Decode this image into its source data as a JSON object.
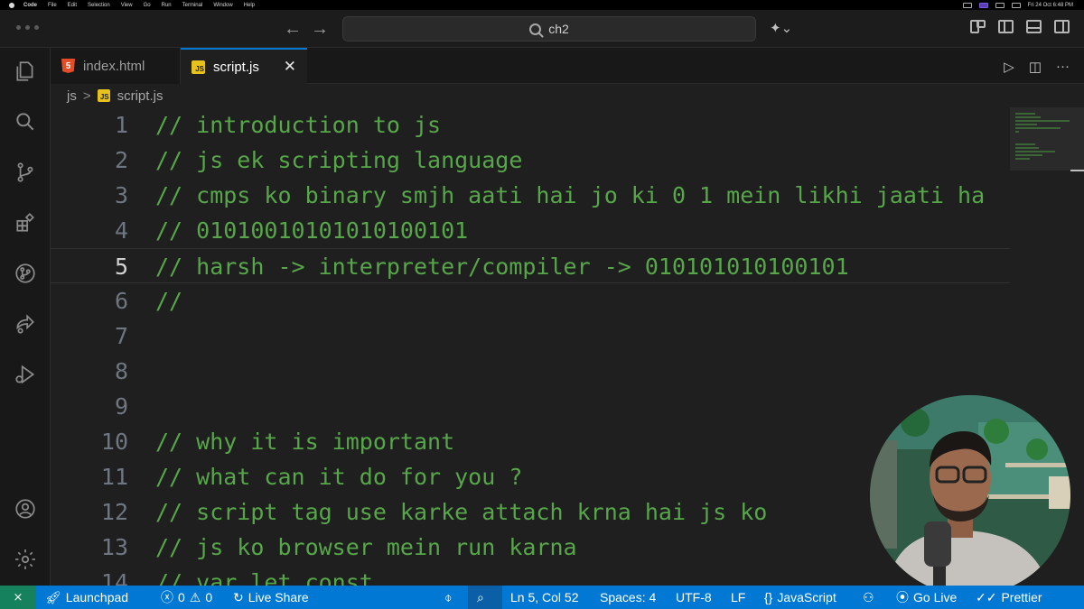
{
  "menubar": {
    "app": "Code",
    "items": [
      "File",
      "Edit",
      "Selection",
      "View",
      "Go",
      "Run",
      "Terminal",
      "Window",
      "Help"
    ],
    "clock": "Fri 24 Oct  6:48 PM"
  },
  "titlebar": {
    "search_text": "ch2",
    "back_arrow": "←",
    "forward_arrow": "→"
  },
  "tabs": [
    {
      "label": "index.html",
      "icon": "html5-icon",
      "active": false
    },
    {
      "label": "script.js",
      "icon": "js-icon",
      "active": true,
      "close": "✕"
    }
  ],
  "editor_actions": {
    "run": "▷",
    "more": "···"
  },
  "breadcrumb": {
    "folder": "js",
    "separator": ">",
    "file": "script.js"
  },
  "code_lines": [
    {
      "n": "1",
      "text": "// introduction to js"
    },
    {
      "n": "2",
      "text": "// js ek scripting language"
    },
    {
      "n": "3",
      "text": "// cmps ko binary smjh aati hai jo ki 0 1 mein likhi jaati ha"
    },
    {
      "n": "4",
      "text": "// 01010010101010100101"
    },
    {
      "n": "5",
      "text": "// harsh -> interpreter/compiler -> 010101010100101"
    },
    {
      "n": "6",
      "text": "//"
    },
    {
      "n": "7",
      "text": ""
    },
    {
      "n": "8",
      "text": ""
    },
    {
      "n": "9",
      "text": ""
    },
    {
      "n": "10",
      "text": "// why it is important"
    },
    {
      "n": "11",
      "text": "// what can it do for you ?"
    },
    {
      "n": "12",
      "text": "// script tag use karke attach krna hai js ko"
    },
    {
      "n": "13",
      "text": "// js ko browser mein run karna"
    },
    {
      "n": "14",
      "text": "// var let const"
    }
  ],
  "current_line": 5,
  "statusbar": {
    "remote": "⨯",
    "launchpad": "Launchpad",
    "errors": "0",
    "warnings": "0",
    "live_share": "Live Share",
    "position": "Ln 5, Col 52",
    "spaces": "Spaces: 4",
    "encoding": "UTF-8",
    "eol": "LF",
    "language": "JavaScript",
    "go_live": "Go Live",
    "prettier": "Prettier"
  },
  "colors": {
    "comment": "#57a64a",
    "statusbar": "#0078d4",
    "editor_bg": "#1f1f1f",
    "tab_accent": "#0078d4"
  }
}
